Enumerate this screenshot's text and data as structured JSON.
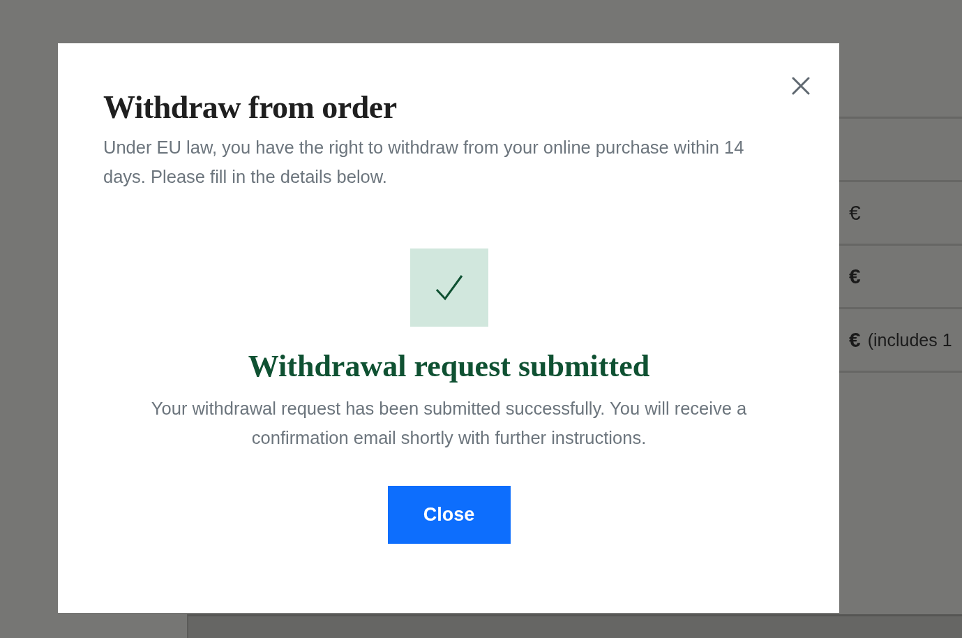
{
  "background": {
    "rows": [
      {
        "amount": "€",
        "bold": false
      },
      {
        "amount": "€",
        "bold": true
      },
      {
        "amount": "€",
        "bold": true,
        "note": "(includes 1"
      }
    ]
  },
  "dialog": {
    "title": "Withdraw from order",
    "intro": "Under EU law, you have the right to withdraw from your online purchase within 14 days. Please fill in the details below.",
    "success": {
      "title": "Withdrawal request submitted",
      "message": "Your withdrawal request has been submitted successfully. You will receive a confirmation email shortly with further instructions."
    },
    "button": "Close"
  }
}
